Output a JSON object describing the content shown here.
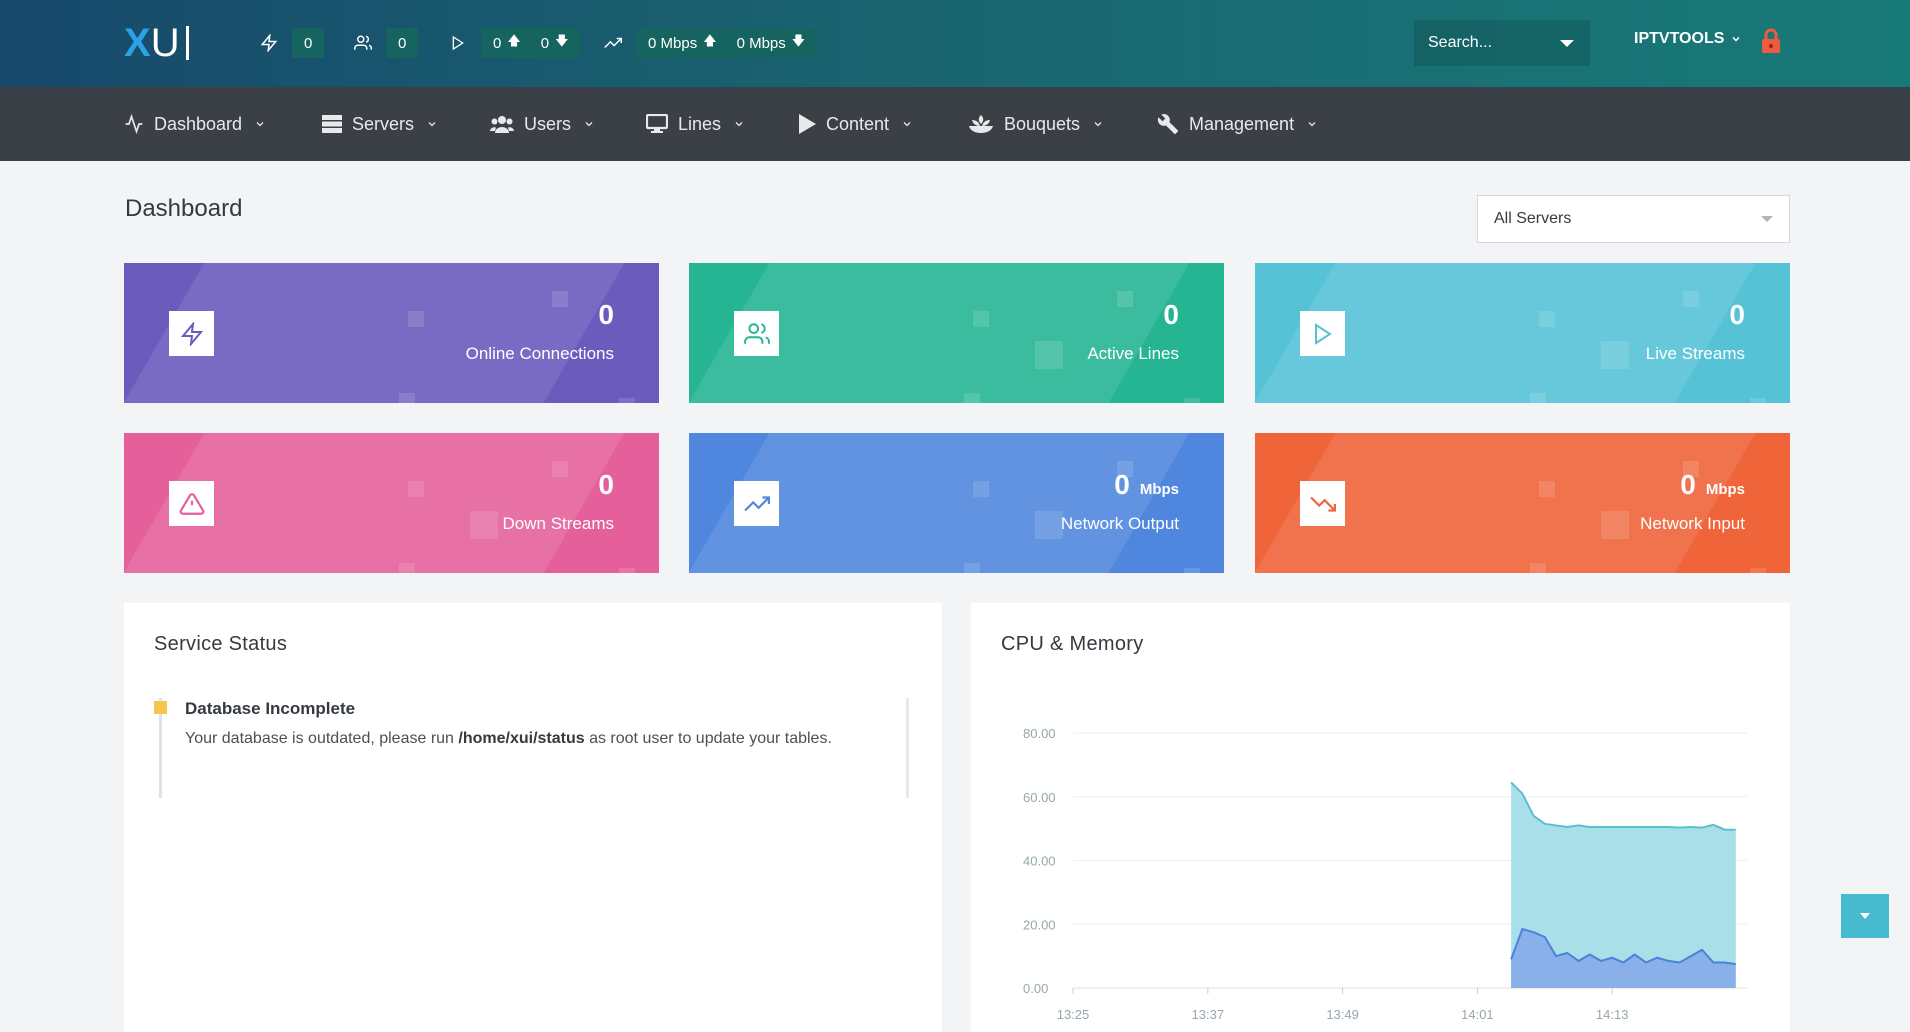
{
  "topbar": {
    "logo_x": "X",
    "logo_u": "U",
    "stats": {
      "connections": "0",
      "users": "0",
      "streams_up": "0",
      "streams_down": "0",
      "bandwidth_out": "0 Mbps",
      "bandwidth_in": "0 Mbps"
    },
    "search_placeholder": "Search...",
    "username": "IPTVTOOLS"
  },
  "nav": [
    {
      "label": "Dashboard",
      "icon": "activity-icon"
    },
    {
      "label": "Servers",
      "icon": "server-icon"
    },
    {
      "label": "Users",
      "icon": "users-icon"
    },
    {
      "label": "Lines",
      "icon": "monitor-icon"
    },
    {
      "label": "Content",
      "icon": "play-icon"
    },
    {
      "label": "Bouquets",
      "icon": "bouquet-icon"
    },
    {
      "label": "Management",
      "icon": "wrench-icon"
    }
  ],
  "page": {
    "title": "Dashboard",
    "server_filter": "All Servers"
  },
  "cards": [
    {
      "value": "0",
      "unit": "",
      "label": "Online Connections",
      "color": "#6a5bbd",
      "icon": "zap-icon"
    },
    {
      "value": "0",
      "unit": "",
      "label": "Active Lines",
      "color": "#25b593",
      "icon": "users-icon"
    },
    {
      "value": "0",
      "unit": "",
      "label": "Live Streams",
      "color": "#55c2d6",
      "icon": "play-icon"
    },
    {
      "value": "0",
      "unit": "",
      "label": "Down Streams",
      "color": "#e5609a",
      "icon": "alert-triangle-icon"
    },
    {
      "value": "0",
      "unit": "Mbps",
      "label": "Network Output",
      "color": "#5087de",
      "icon": "trending-up-icon"
    },
    {
      "value": "0",
      "unit": "Mbps",
      "label": "Network Input",
      "color": "#ef6439",
      "icon": "trending-down-icon"
    }
  ],
  "service_status": {
    "title": "Service Status",
    "item_title": "Database Incomplete",
    "msg_before": "Your database is outdated, please run ",
    "msg_cmd": "/home/xui/status",
    "msg_after": " as root user to update your tables."
  },
  "cpu_memory": {
    "title": "CPU & Memory"
  },
  "chart_data": {
    "type": "area",
    "title": "CPU & Memory",
    "x_ticks": [
      "13:25",
      "13:37",
      "13:49",
      "14:01",
      "14:13"
    ],
    "y_ticks": [
      "0.00",
      "20.00",
      "40.00",
      "60.00",
      "80.00"
    ],
    "ylim": [
      0,
      80
    ],
    "grid": true,
    "colors": {
      "memory": "#a9dfe8",
      "memory_line": "#5bbfd2",
      "cpu": "#8ab0ea",
      "cpu_line": "#4a82d8"
    },
    "series": [
      {
        "x": [
          "14:04",
          "14:05",
          "14:06",
          "14:07",
          "14:08",
          "14:09",
          "14:10",
          "14:11",
          "14:12",
          "14:13",
          "14:14",
          "14:15",
          "14:16",
          "14:17",
          "14:18",
          "14:19",
          "14:20",
          "14:21",
          "14:22",
          "14:23",
          "14:24"
        ],
        "values": [
          64.5,
          61,
          54,
          51.5,
          51,
          50.5,
          51,
          50.5,
          50.5,
          50.5,
          50.5,
          50.5,
          50.5,
          50.5,
          50.5,
          50.3,
          50.5,
          50.3,
          51.2,
          49.7,
          49.6
        ]
      },
      {
        "x": [
          "14:04",
          "14:05",
          "14:06",
          "14:07",
          "14:08",
          "14:09",
          "14:10",
          "14:11",
          "14:12",
          "14:13",
          "14:14",
          "14:15",
          "14:16",
          "14:17",
          "14:18",
          "14:19",
          "14:20",
          "14:21",
          "14:22",
          "14:23",
          "14:24"
        ],
        "values": [
          9,
          18.5,
          17.5,
          16,
          10,
          11,
          8.5,
          10.5,
          8.5,
          9.5,
          8,
          10.5,
          8,
          9.5,
          8.5,
          8,
          10,
          12,
          8,
          8,
          7.5
        ]
      }
    ]
  }
}
